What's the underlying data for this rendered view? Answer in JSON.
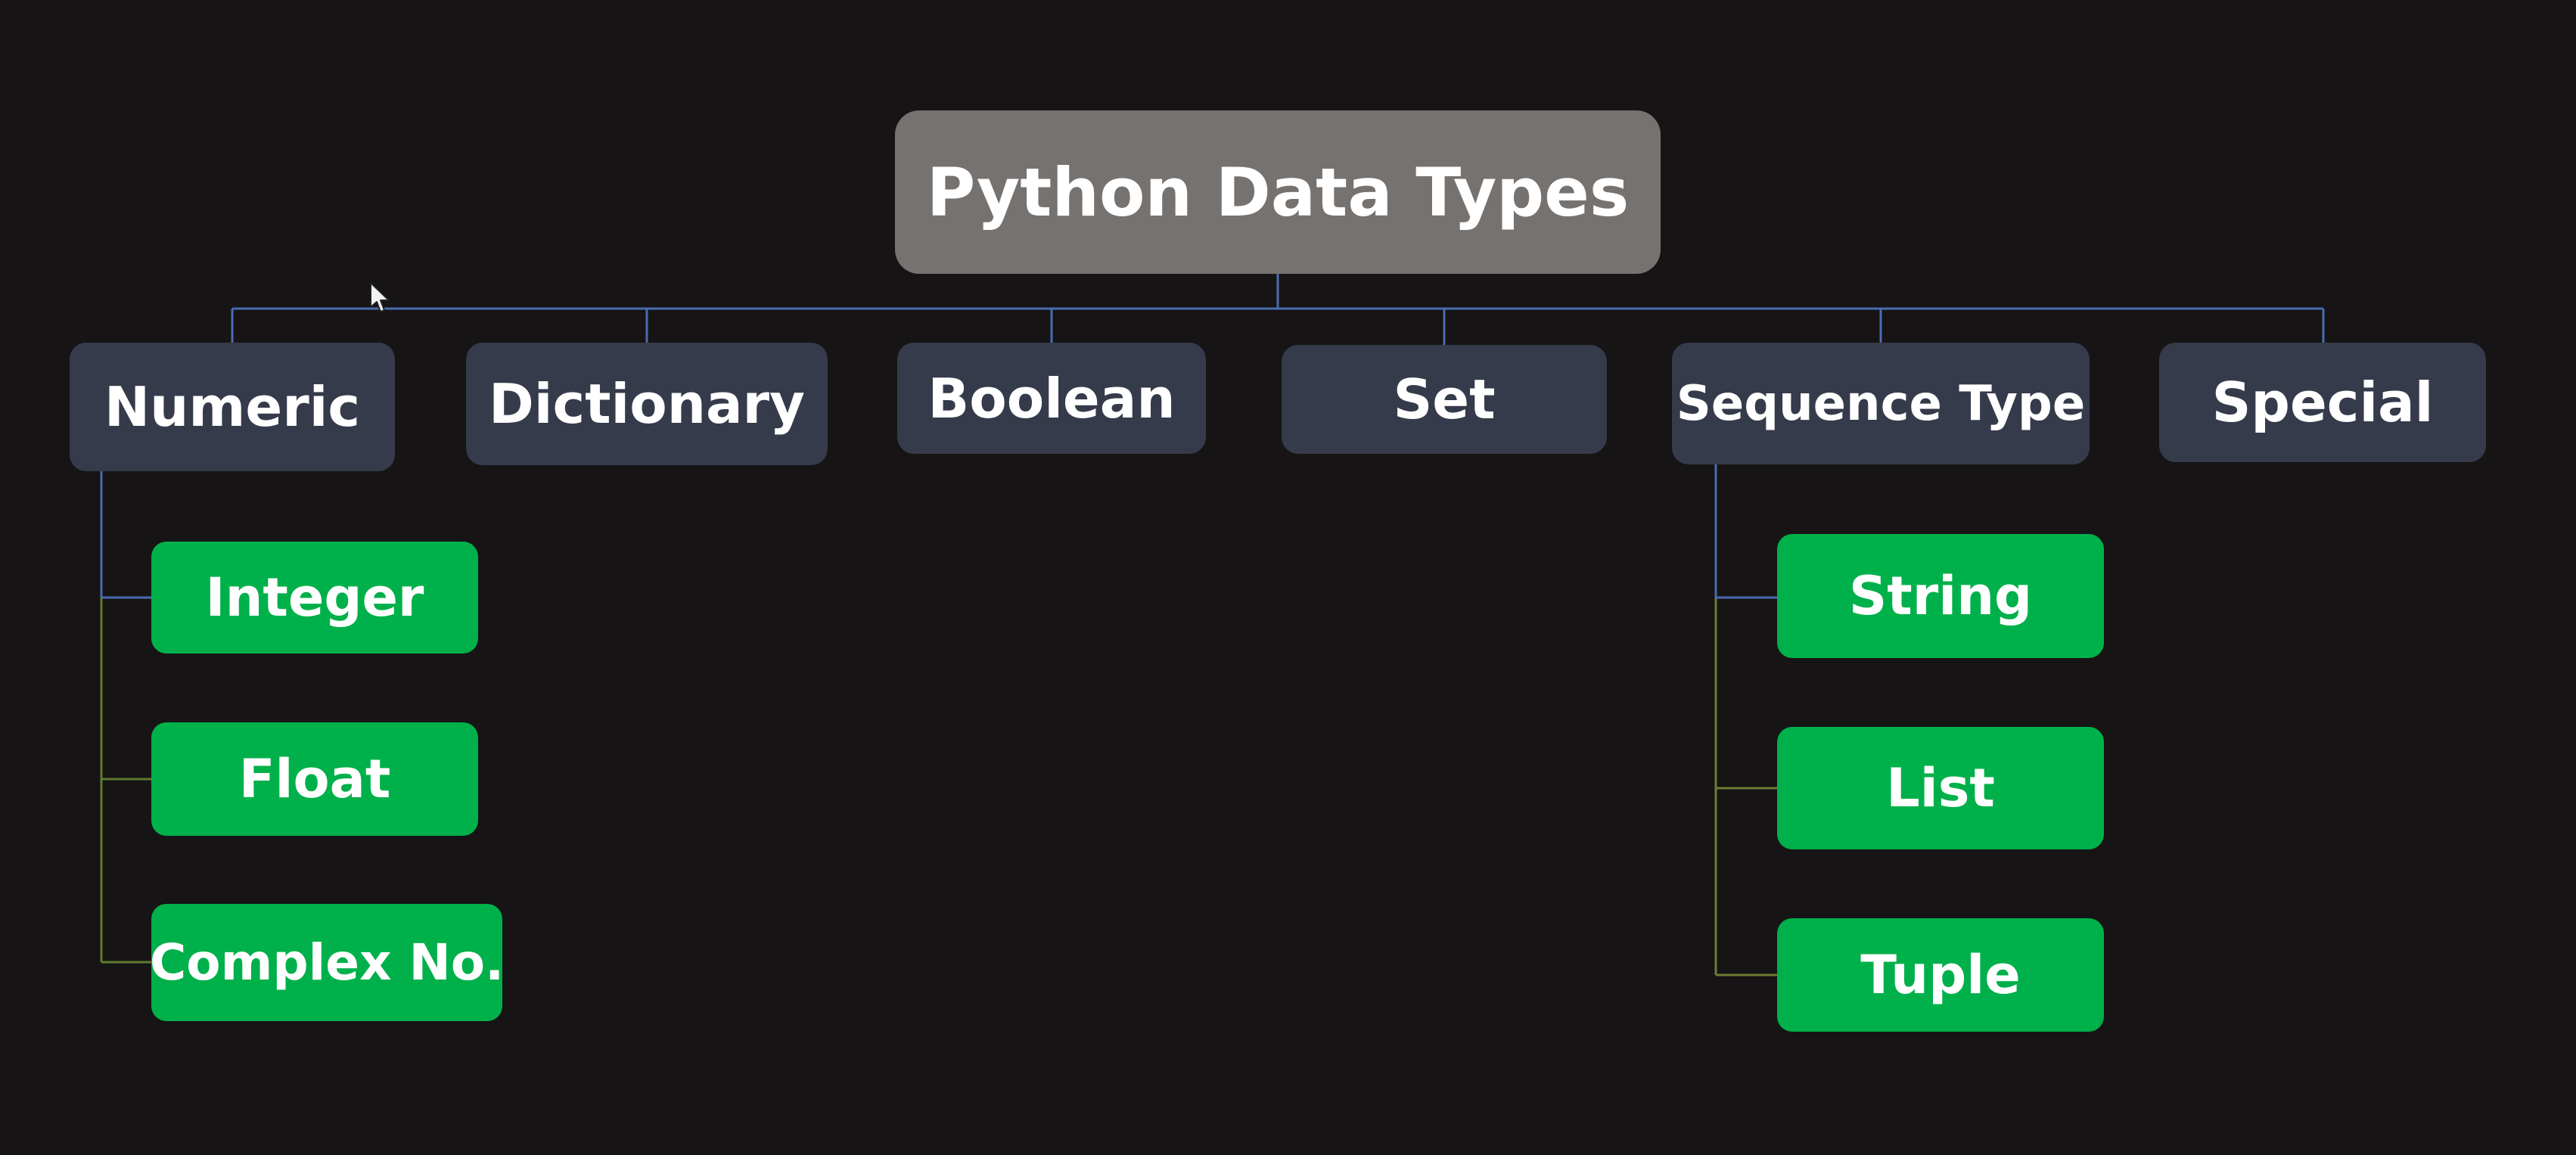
{
  "diagram": {
    "root": {
      "label": "Python Data Types"
    },
    "categories": [
      {
        "label": "Numeric"
      },
      {
        "label": "Dictionary"
      },
      {
        "label": "Boolean"
      },
      {
        "label": "Set"
      },
      {
        "label": "Sequence Type"
      },
      {
        "label": "Special"
      }
    ],
    "numeric_subtypes": [
      {
        "label": "Integer"
      },
      {
        "label": "Float"
      },
      {
        "label": "Complex No."
      }
    ],
    "sequence_subtypes": [
      {
        "label": "String"
      },
      {
        "label": "List"
      },
      {
        "label": "Tuple"
      }
    ]
  },
  "colors": {
    "background": "#161415",
    "root_fill": "#767270",
    "category_fill": "#353b4b",
    "subtype_fill": "#00b04a",
    "root_connector": "#4a6cb0",
    "numeric_connector": "#5d7b2e",
    "sequence_connector": "#6f7c35",
    "text": "#ffffff"
  }
}
